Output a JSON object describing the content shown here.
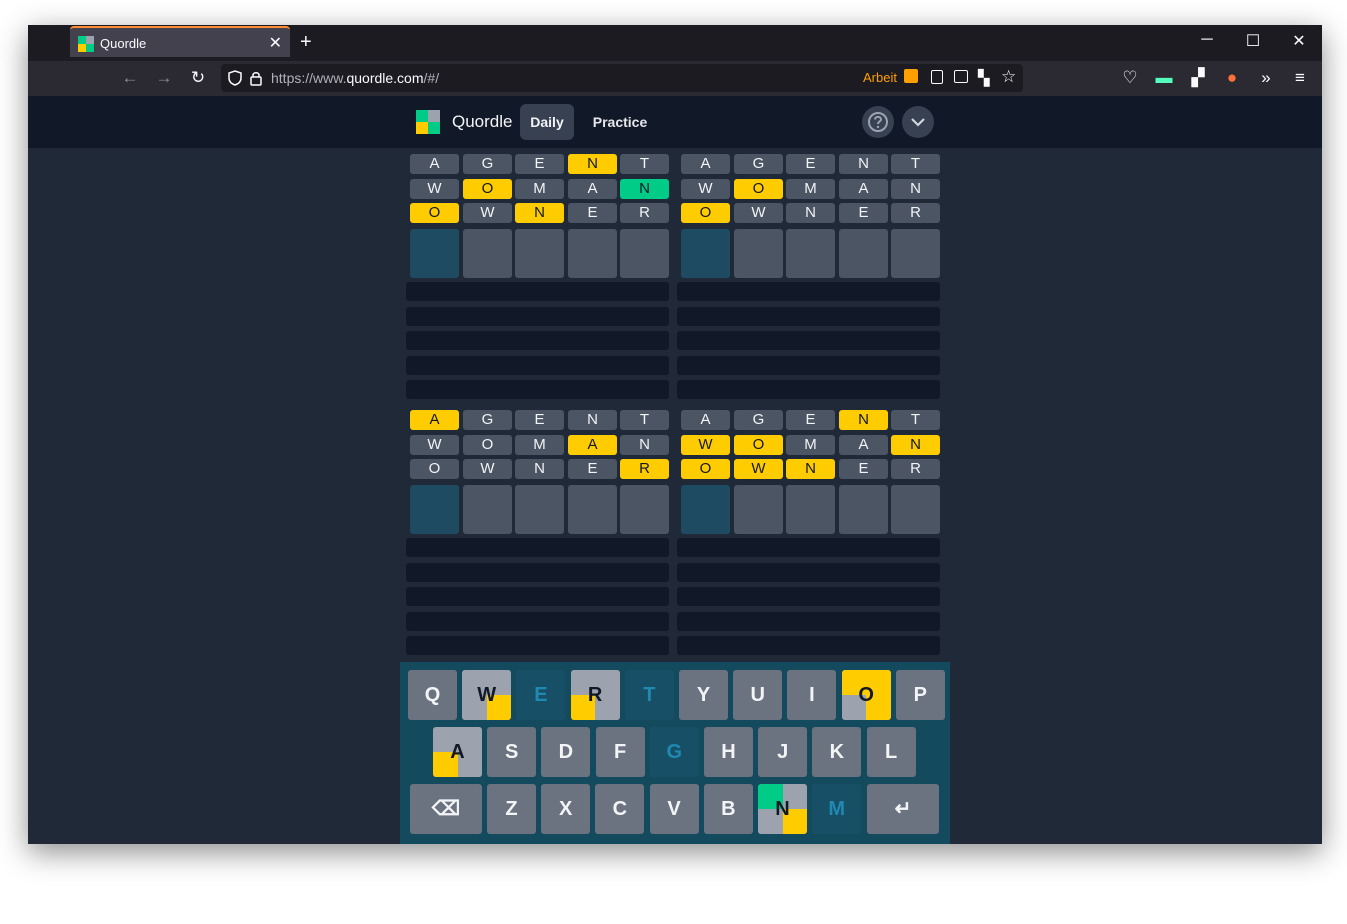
{
  "browser": {
    "tab_title": "Quordle",
    "new_tab_label": "+",
    "close_tab_label": "✕",
    "minimize_label": "─",
    "maximize_label": "☐",
    "close_window_label": "✕",
    "url_prefix": "https://www.",
    "url_domain": "quordle.com",
    "url_suffix": "/#/",
    "container_label": "Arbeit"
  },
  "app": {
    "title": "Quordle",
    "nav": {
      "daily": "Daily",
      "practice": "Practice"
    }
  },
  "colors": {
    "yellow": "#ffcc00",
    "green": "#00cc88",
    "gray": "#4b5563",
    "keyboard_bg": "#134a5e"
  },
  "boards": [
    {
      "rows": [
        [
          [
            "A",
            "n"
          ],
          [
            "G",
            "n"
          ],
          [
            "E",
            "n"
          ],
          [
            "N",
            "y"
          ],
          [
            "T",
            "n"
          ]
        ],
        [
          [
            "W",
            "n"
          ],
          [
            "O",
            "y"
          ],
          [
            "M",
            "n"
          ],
          [
            "A",
            "n"
          ],
          [
            "N",
            "g"
          ]
        ],
        [
          [
            "O",
            "y"
          ],
          [
            "W",
            "n"
          ],
          [
            "N",
            "y"
          ],
          [
            "E",
            "n"
          ],
          [
            "R",
            "n"
          ]
        ]
      ]
    },
    {
      "rows": [
        [
          [
            "A",
            "n"
          ],
          [
            "G",
            "n"
          ],
          [
            "E",
            "n"
          ],
          [
            "N",
            "n"
          ],
          [
            "T",
            "n"
          ]
        ],
        [
          [
            "W",
            "n"
          ],
          [
            "O",
            "y"
          ],
          [
            "M",
            "n"
          ],
          [
            "A",
            "n"
          ],
          [
            "N",
            "n"
          ]
        ],
        [
          [
            "O",
            "y"
          ],
          [
            "W",
            "n"
          ],
          [
            "N",
            "n"
          ],
          [
            "E",
            "n"
          ],
          [
            "R",
            "n"
          ]
        ]
      ]
    },
    {
      "rows": [
        [
          [
            "A",
            "y"
          ],
          [
            "G",
            "n"
          ],
          [
            "E",
            "n"
          ],
          [
            "N",
            "n"
          ],
          [
            "T",
            "n"
          ]
        ],
        [
          [
            "W",
            "n"
          ],
          [
            "O",
            "n"
          ],
          [
            "M",
            "n"
          ],
          [
            "A",
            "y"
          ],
          [
            "N",
            "n"
          ]
        ],
        [
          [
            "O",
            "n"
          ],
          [
            "W",
            "n"
          ],
          [
            "N",
            "n"
          ],
          [
            "E",
            "n"
          ],
          [
            "R",
            "y"
          ]
        ]
      ]
    },
    {
      "rows": [
        [
          [
            "A",
            "n"
          ],
          [
            "G",
            "n"
          ],
          [
            "E",
            "n"
          ],
          [
            "N",
            "y"
          ],
          [
            "T",
            "n"
          ]
        ],
        [
          [
            "W",
            "y"
          ],
          [
            "O",
            "y"
          ],
          [
            "M",
            "n"
          ],
          [
            "A",
            "n"
          ],
          [
            "N",
            "y"
          ]
        ],
        [
          [
            "O",
            "y"
          ],
          [
            "W",
            "y"
          ],
          [
            "N",
            "y"
          ],
          [
            "E",
            "n"
          ],
          [
            "R",
            "n"
          ]
        ]
      ]
    }
  ],
  "keyboard": {
    "row1": [
      {
        "k": "Q",
        "s": "plain"
      },
      {
        "k": "W",
        "s": "quad",
        "q": [
          "gray",
          "gray",
          "gray",
          "yellow"
        ]
      },
      {
        "k": "E",
        "s": "gone"
      },
      {
        "k": "R",
        "s": "quad",
        "q": [
          "gray",
          "gray",
          "yellow",
          "gray"
        ]
      },
      {
        "k": "T",
        "s": "gone"
      },
      {
        "k": "Y",
        "s": "plain"
      },
      {
        "k": "U",
        "s": "plain"
      },
      {
        "k": "I",
        "s": "plain"
      },
      {
        "k": "O",
        "s": "quad",
        "q": [
          "yellow",
          "yellow",
          "gray",
          "yellow"
        ]
      },
      {
        "k": "P",
        "s": "plain"
      }
    ],
    "row2": [
      {
        "k": "A",
        "s": "quad",
        "q": [
          "gray",
          "gray",
          "yellow",
          "gray"
        ]
      },
      {
        "k": "S",
        "s": "plain"
      },
      {
        "k": "D",
        "s": "plain"
      },
      {
        "k": "F",
        "s": "plain"
      },
      {
        "k": "G",
        "s": "gone"
      },
      {
        "k": "H",
        "s": "plain"
      },
      {
        "k": "J",
        "s": "plain"
      },
      {
        "k": "K",
        "s": "plain"
      },
      {
        "k": "L",
        "s": "plain"
      }
    ],
    "row3": [
      {
        "k": "Z",
        "s": "plain"
      },
      {
        "k": "X",
        "s": "plain"
      },
      {
        "k": "C",
        "s": "plain"
      },
      {
        "k": "V",
        "s": "plain"
      },
      {
        "k": "B",
        "s": "plain"
      },
      {
        "k": "N",
        "s": "quad",
        "q": [
          "green",
          "gray",
          "gray",
          "yellow"
        ]
      },
      {
        "k": "M",
        "s": "gone"
      }
    ],
    "backspace_label": "⌫",
    "enter_label": "↵"
  }
}
